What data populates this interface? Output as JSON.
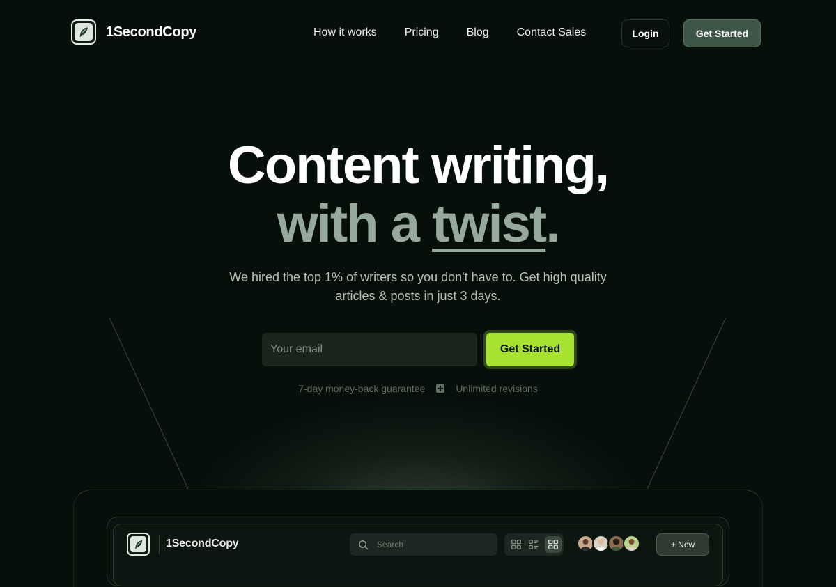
{
  "brand": {
    "name": "1SecondCopy"
  },
  "nav": {
    "links": [
      "How it works",
      "Pricing",
      "Blog",
      "Contact Sales"
    ],
    "login_label": "Login",
    "cta_label": "Get Started"
  },
  "hero": {
    "line1": "Content writing,",
    "line2_prefix": "with a ",
    "line2_emphasis": "twist",
    "line2_suffix": ".",
    "subtitle": "We hired the top 1% of writers so you don't have to. Get high quality articles & posts in just 3 days.",
    "email_placeholder": "Your email",
    "cta_label": "Get Started",
    "guarantee_1": "7-day money-back guarantee",
    "guarantee_2": "Unlimited revisions"
  },
  "app_preview": {
    "brand_name": "1SecondCopy",
    "search_placeholder": "Search",
    "views": [
      "grid-view",
      "list-view",
      "board-view"
    ],
    "active_view": "board-view",
    "new_button_label": "+ New",
    "avatar_colors": [
      "#c9a98a",
      "#d9d2c4",
      "#8a6a52",
      "#b9d48a"
    ]
  },
  "colors": {
    "background": "#060f0a",
    "accent": "#a6e22f",
    "muted_heading": "#97a99c",
    "nav_cta": "#3c5545"
  }
}
